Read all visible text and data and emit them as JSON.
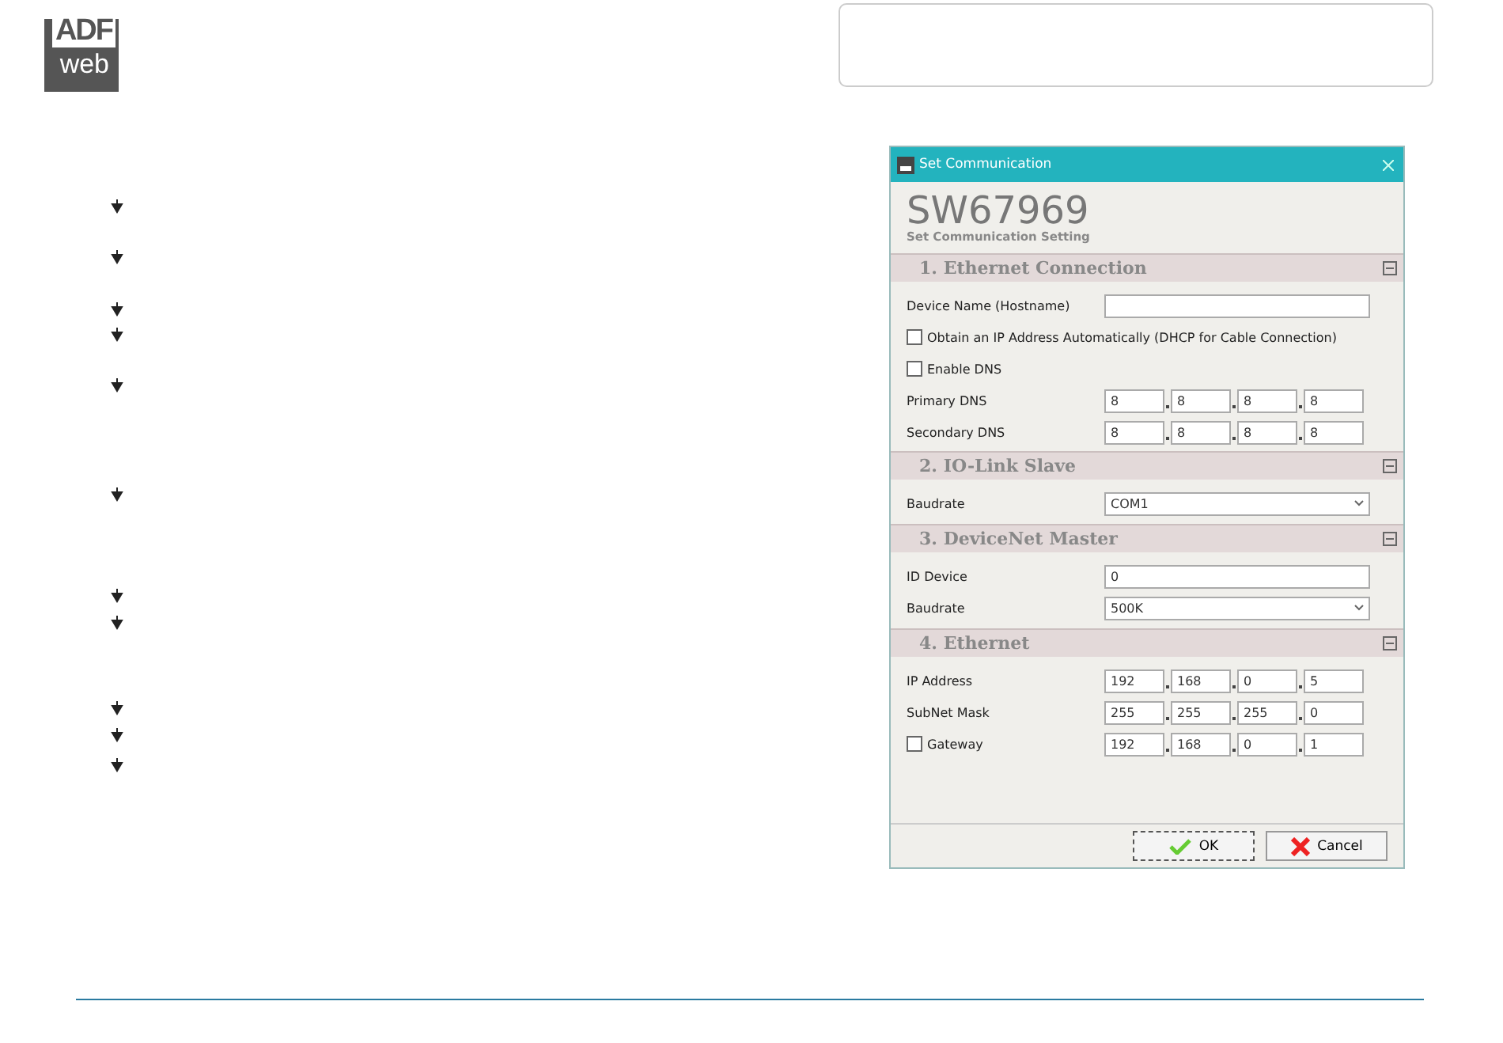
{
  "logo": {
    "top": "ADF",
    "bottom": "web"
  },
  "dialog": {
    "title": "Set Communication",
    "heading": "SW67969",
    "subtitle": "Set Communication Setting",
    "sections": [
      {
        "title": "1. Ethernet Connection",
        "rows": [
          {
            "kind": "text",
            "label": "Device Name (Hostname)",
            "value": ""
          },
          {
            "kind": "check",
            "label": "Obtain an IP Address Automatically (DHCP for Cable Connection)",
            "checked": false
          },
          {
            "kind": "check",
            "label": "Enable DNS",
            "checked": false
          },
          {
            "kind": "ip",
            "label": "Primary DNS",
            "parts": [
              "8",
              "8",
              "8",
              "8"
            ]
          },
          {
            "kind": "ip",
            "label": "Secondary DNS",
            "parts": [
              "8",
              "8",
              "8",
              "8"
            ]
          }
        ]
      },
      {
        "title": "2. IO-Link Slave",
        "rows": [
          {
            "kind": "select",
            "label": "Baudrate",
            "value": "COM1"
          }
        ]
      },
      {
        "title": "3. DeviceNet Master",
        "rows": [
          {
            "kind": "text",
            "label": "ID Device",
            "value": "0"
          },
          {
            "kind": "select",
            "label": "Baudrate",
            "value": "500K"
          }
        ]
      },
      {
        "title": "4. Ethernet",
        "rows": [
          {
            "kind": "ip",
            "label": "IP Address",
            "parts": [
              "192",
              "168",
              "0",
              "5"
            ]
          },
          {
            "kind": "ip",
            "label": "SubNet Mask",
            "parts": [
              "255",
              "255",
              "255",
              "0"
            ]
          },
          {
            "kind": "checkip",
            "label": "Gateway",
            "checked": false,
            "parts": [
              "192",
              "168",
              "0",
              "1"
            ]
          }
        ]
      }
    ],
    "buttons": [
      {
        "kind": "ok",
        "label": "OK"
      },
      {
        "kind": "cancel",
        "label": "Cancel"
      }
    ]
  }
}
